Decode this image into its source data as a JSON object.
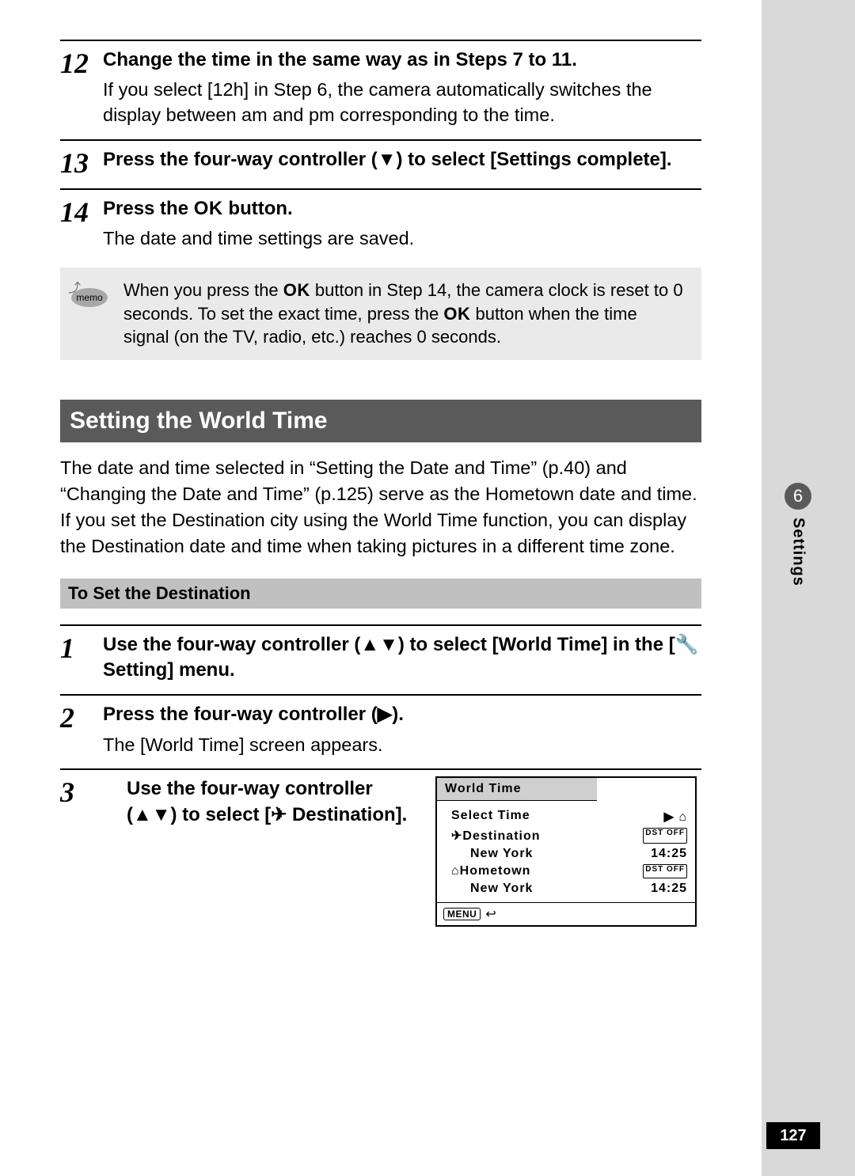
{
  "side": {
    "chapter": "6",
    "label": "Settings"
  },
  "pageNumber": "127",
  "steps_a": [
    {
      "num": "12",
      "title": "Change the time in the same way as in Steps 7 to 11.",
      "desc": "If you select [12h] in Step 6, the camera automatically switches the display between am and pm corresponding to the time."
    },
    {
      "num": "13",
      "title": "Press the four-way controller (▼) to select [Settings complete].",
      "desc": ""
    },
    {
      "num": "14",
      "title_pre": "Press the ",
      "title_ok": "OK",
      "title_post": " button.",
      "desc": "The date and time settings are saved."
    }
  ],
  "memo": {
    "label": "memo",
    "text_pre": "When you press the ",
    "ok1": "OK",
    "text_mid": " button in Step 14, the camera clock is reset to 0 seconds. To set the exact time, press the ",
    "ok2": "OK",
    "text_post": " button when the time signal (on the TV, radio, etc.) reaches 0 seconds."
  },
  "section": {
    "title": "Setting the World Time",
    "intro": "The date and time selected in “Setting the Date and Time” (p.40) and “Changing the Date and Time” (p.125) serve as the Hometown date and time. If you set the Destination city using the World Time function, you can display the Destination date and time when taking pictures in a different time zone."
  },
  "subhead": "To Set the Destination",
  "steps_b": [
    {
      "num": "1",
      "title": "Use the four-way controller (▲▼) to select [World Time] in the [🔧 Setting] menu.",
      "desc": ""
    },
    {
      "num": "2",
      "title": "Press the four-way controller (▶).",
      "desc": "The [World Time] screen appears."
    },
    {
      "num": "3",
      "title": "Use the four-way controller (▲▼) to select [✈ Destination].",
      "desc": ""
    }
  ],
  "lcd": {
    "title": "World Time",
    "selectTime": "Select Time",
    "selectGlyph": "▶ ⌂",
    "dest_label": "✈Destination",
    "dest_city": "New York",
    "dest_dst": "DST OFF",
    "dest_time": "14:25",
    "home_label": "⌂Hometown",
    "home_city": "New York",
    "home_dst": "DST OFF",
    "home_time": "14:25",
    "menu": "MENU",
    "back": "↩"
  }
}
